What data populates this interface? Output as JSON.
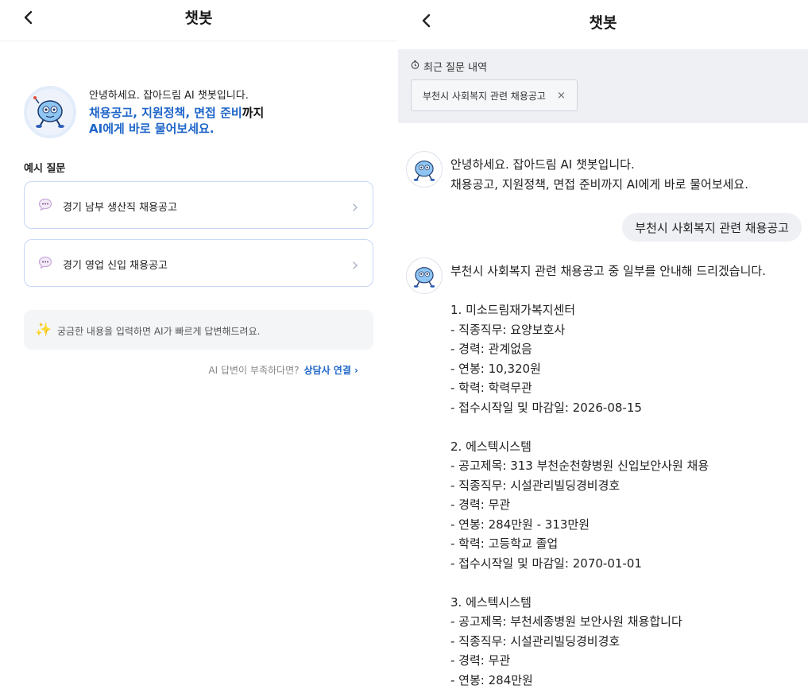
{
  "left": {
    "title": "챗봇",
    "intro_line1": "안녕하세요. 잡아드림 AI 챗봇입니다.",
    "intro_line2_blue": "채용공고, 지원정책, 면접 준비",
    "intro_line2_dark": "까지",
    "intro_line3": "AI에게 바로 물어보세요.",
    "examples_label": "예시 질문",
    "examples": [
      "경기 남부 생산직 채용공고",
      "경기 영업 신입 채용공고"
    ],
    "tip": "궁금한 내용을 입력하면 AI가 빠르게 답변해드려요.",
    "counsel_prompt": "AI 답변이 부족하다면?",
    "counsel_link": "상담사 연결 ›"
  },
  "right": {
    "title": "챗봇",
    "recent_label": "최근 질문 내역",
    "recent_chip": "부천시 사회복지 관련 채용공고",
    "chip_close": "×",
    "greeting": "안녕하세요. 잡아드림 AI 챗봇입니다.\n채용공고, 지원정책, 면접 준비까지 AI에게 바로 물어보세요.",
    "user_message": "부천시 사회복지 관련 채용공고",
    "answer": "부천시 사회복지 관련 채용공고 중 일부를 안내해 드리겠습니다.\n\n1. 미소드림재가복지센터\n- 직종직무: 요양보호사\n- 경력: 관계없음\n- 연봉: 10,320원\n- 학력: 학력무관\n- 접수시작일 및 마감일: 2026-08-15\n\n2. 에스텍시스템\n- 공고제목: 313 부천순천향병원 신입보안사원 채용\n- 직종직무: 시설관리빌딩경비경호\n- 경력: 무관\n- 연봉: 284만원 - 313만원\n- 학력: 고등학교 졸업\n- 접수시작일 및 마감일: 2070-01-01\n\n3. 에스텍시스템\n- 공고제목: 부천세종병원 보안사원 채용합니다\n- 직종직무: 시설관리빌딩경비경호\n- 경력: 무관\n- 연봉: 284만원"
  },
  "colors": {
    "accent_blue": "#1f66c9",
    "card_border": "#c6d7f5",
    "panel_gray": "#eef0f4"
  },
  "icons": [
    "back-arrow-icon",
    "chatbot-mascot-icon",
    "speech-bubble-icon",
    "chevron-right-icon",
    "sparkle-icon",
    "clock-icon",
    "close-icon"
  ]
}
